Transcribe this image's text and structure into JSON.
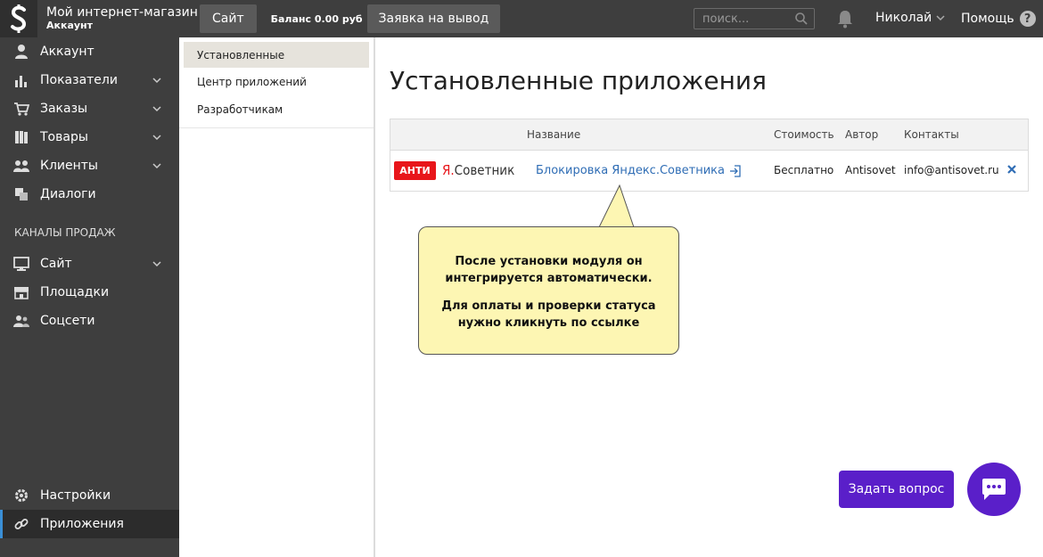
{
  "topbar": {
    "shop_name": "Мой интернет-магазин",
    "shop_sub": "Аккаунт",
    "site_button": "Сайт",
    "balance": "Баланс 0.00 руб",
    "withdraw_button": "Заявка на вывод",
    "search_placeholder": "поиск...",
    "user": "Николай",
    "help": "Помощь",
    "help_glyph": "?"
  },
  "sidebar": {
    "items": [
      {
        "label": "Аккаунт",
        "icon": "user-icon"
      },
      {
        "label": "Показатели",
        "icon": "chart-icon"
      },
      {
        "label": "Заказы",
        "icon": "cart-icon"
      },
      {
        "label": "Товары",
        "icon": "books-icon"
      },
      {
        "label": "Клиенты",
        "icon": "users-icon"
      },
      {
        "label": "Диалоги",
        "icon": "dialog-icon"
      }
    ],
    "section_title": "КАНАЛЫ ПРОДАЖ",
    "channels": [
      {
        "label": "Сайт",
        "icon": "monitor-icon"
      },
      {
        "label": "Площадки",
        "icon": "store-icon"
      },
      {
        "label": "Соцсети",
        "icon": "social-icon"
      }
    ],
    "bottom": [
      {
        "label": "Настройки",
        "icon": "gear-icon"
      },
      {
        "label": "Приложения",
        "icon": "link-icon"
      }
    ]
  },
  "submenu": {
    "items": [
      "Установленные",
      "Центр приложений",
      "Разработчикам"
    ]
  },
  "main": {
    "title": "Установленные приложения",
    "table": {
      "headers": [
        "Название",
        "Стоимость",
        "Автор",
        "Контакты"
      ],
      "row": {
        "logo_badge": "АНТИ",
        "logo_ya": "Я.",
        "logo_word": "Советник",
        "name": "Блокировка Яндекс.Советника",
        "price": "Бесплатно",
        "author": "Antisovet",
        "contacts": "info@antisovet.ru"
      }
    }
  },
  "callout": {
    "line1": "После установки модуля он интегрируется автоматически.",
    "line2": "Для оплаты и проверки статуса нужно кликнуть по ссылке"
  },
  "support": {
    "ask_button": "Задать вопрос"
  },
  "colors": {
    "accent": "#5a1fc9",
    "link": "#2f6db5",
    "sidebar": "#3e3e3e",
    "callout": "#fdf6b3"
  }
}
